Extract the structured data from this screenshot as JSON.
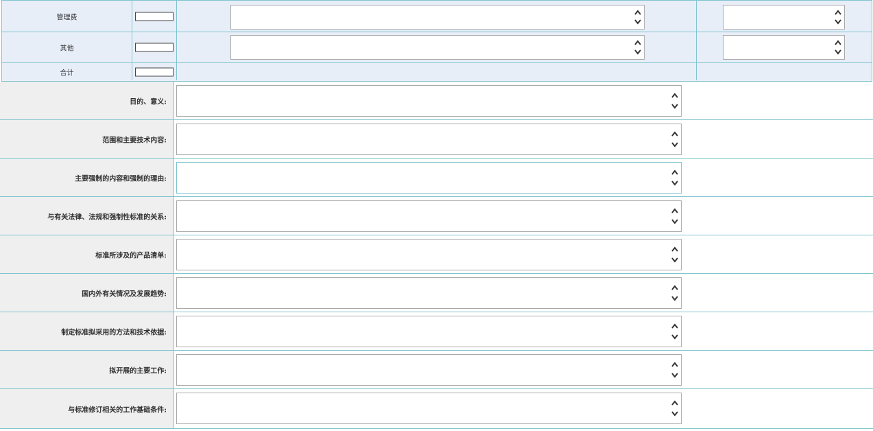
{
  "budget": {
    "rows": [
      {
        "label": "管理费"
      },
      {
        "label": "其他"
      },
      {
        "label": "合计"
      }
    ]
  },
  "description": {
    "fields": [
      {
        "label": "目的、意义:"
      },
      {
        "label": "范围和主要技术内容:"
      },
      {
        "label": "主要强制的内容和强制的理由:"
      },
      {
        "label": "与有关法律、法规和强制性标准的关系:"
      },
      {
        "label": "标准所涉及的产品清单:"
      },
      {
        "label": "国内外有关情况及发展趋势:"
      },
      {
        "label": "制定标准拟采用的方法和技术依据:"
      },
      {
        "label": "拟开展的主要工作:"
      },
      {
        "label": "与标准修订相关的工作基础条件:"
      }
    ]
  }
}
